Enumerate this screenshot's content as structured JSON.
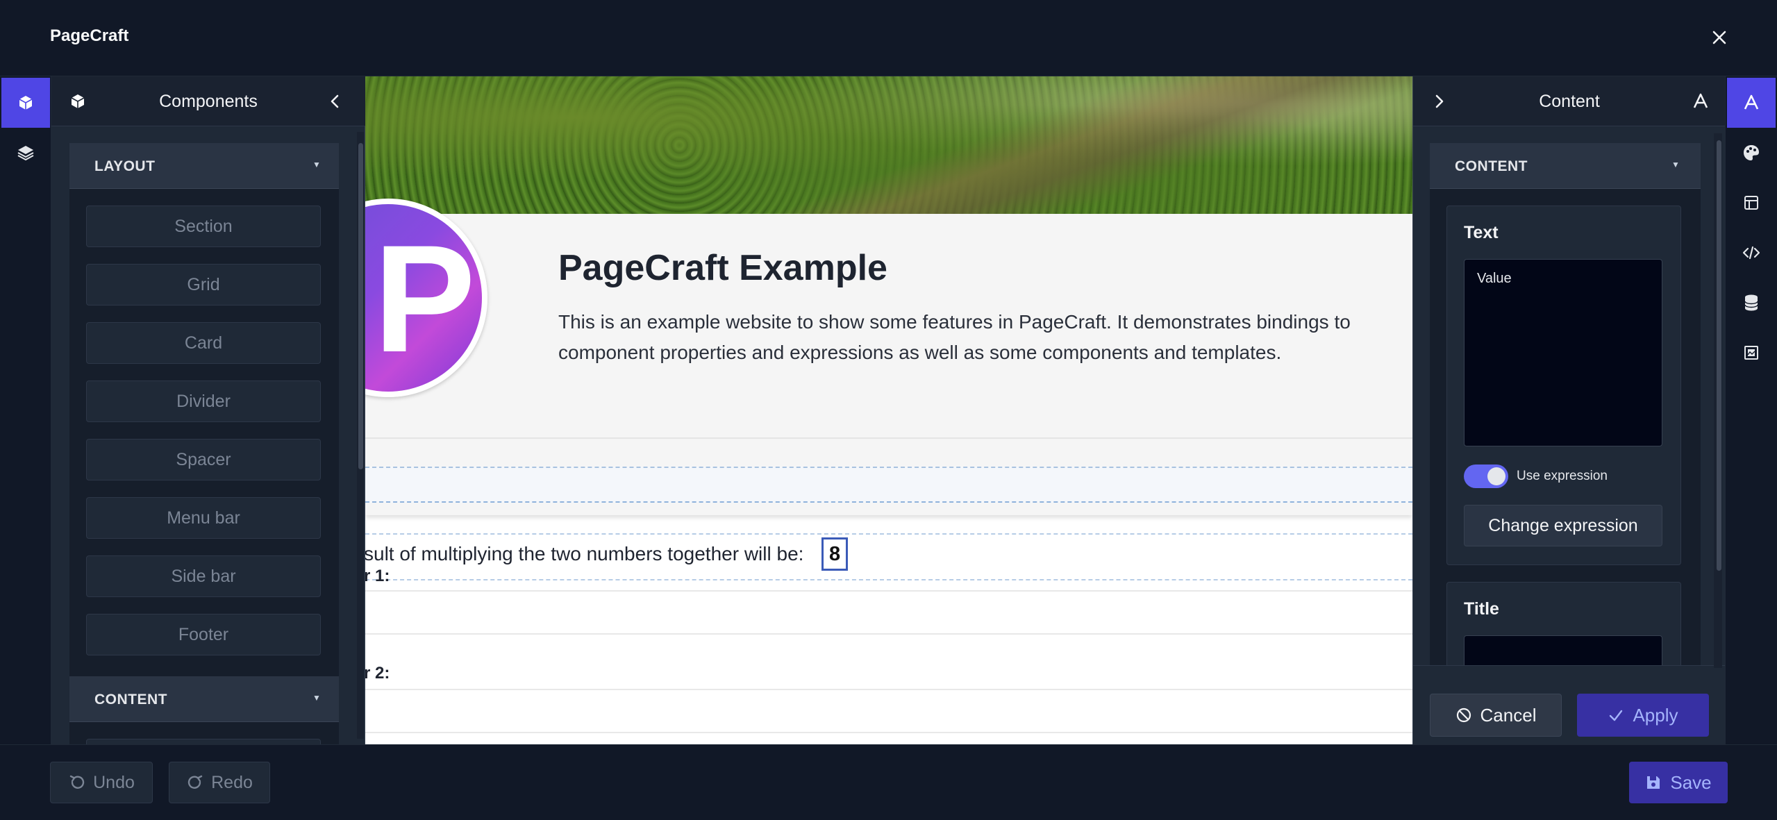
{
  "app": {
    "title": "PageCraft"
  },
  "left_panel": {
    "title": "Components",
    "sections": [
      {
        "label": "LAYOUT",
        "items": [
          "Section",
          "Grid",
          "Card",
          "Divider",
          "Spacer",
          "Menu bar",
          "Side bar",
          "Footer"
        ]
      },
      {
        "label": "CONTENT",
        "items": []
      }
    ]
  },
  "canvas": {
    "logo_letter": "P",
    "site_title": "PageCraft Example",
    "site_description": "This is an example website to show some features in PageCraft. It demonstrates bindings to component properties and expressions as well as some components and templates.",
    "result_text": "sult of multiplying the two numbers together will be:",
    "result_value": "8",
    "number1_label": "r 1:",
    "number2_label": "r 2:"
  },
  "right_panel": {
    "title": "Content",
    "section_label": "CONTENT",
    "text_card": {
      "title": "Text",
      "value": "Value",
      "toggle_label": "Use expression",
      "toggle_on": true,
      "change_button": "Change expression"
    },
    "title_card": {
      "title": "Title"
    },
    "cancel_label": "Cancel",
    "apply_label": "Apply"
  },
  "bottom": {
    "undo_label": "Undo",
    "redo_label": "Redo",
    "save_label": "Save"
  },
  "colors": {
    "accent": "#4f46e5",
    "background": "#111827",
    "panel": "#1f2937"
  },
  "icons": {
    "left_rail": [
      "cube-icon",
      "layers-icon"
    ],
    "right_rail": [
      "font-icon",
      "palette-icon",
      "layout-icon",
      "code-icon",
      "database-icon",
      "image-frame-icon"
    ]
  }
}
